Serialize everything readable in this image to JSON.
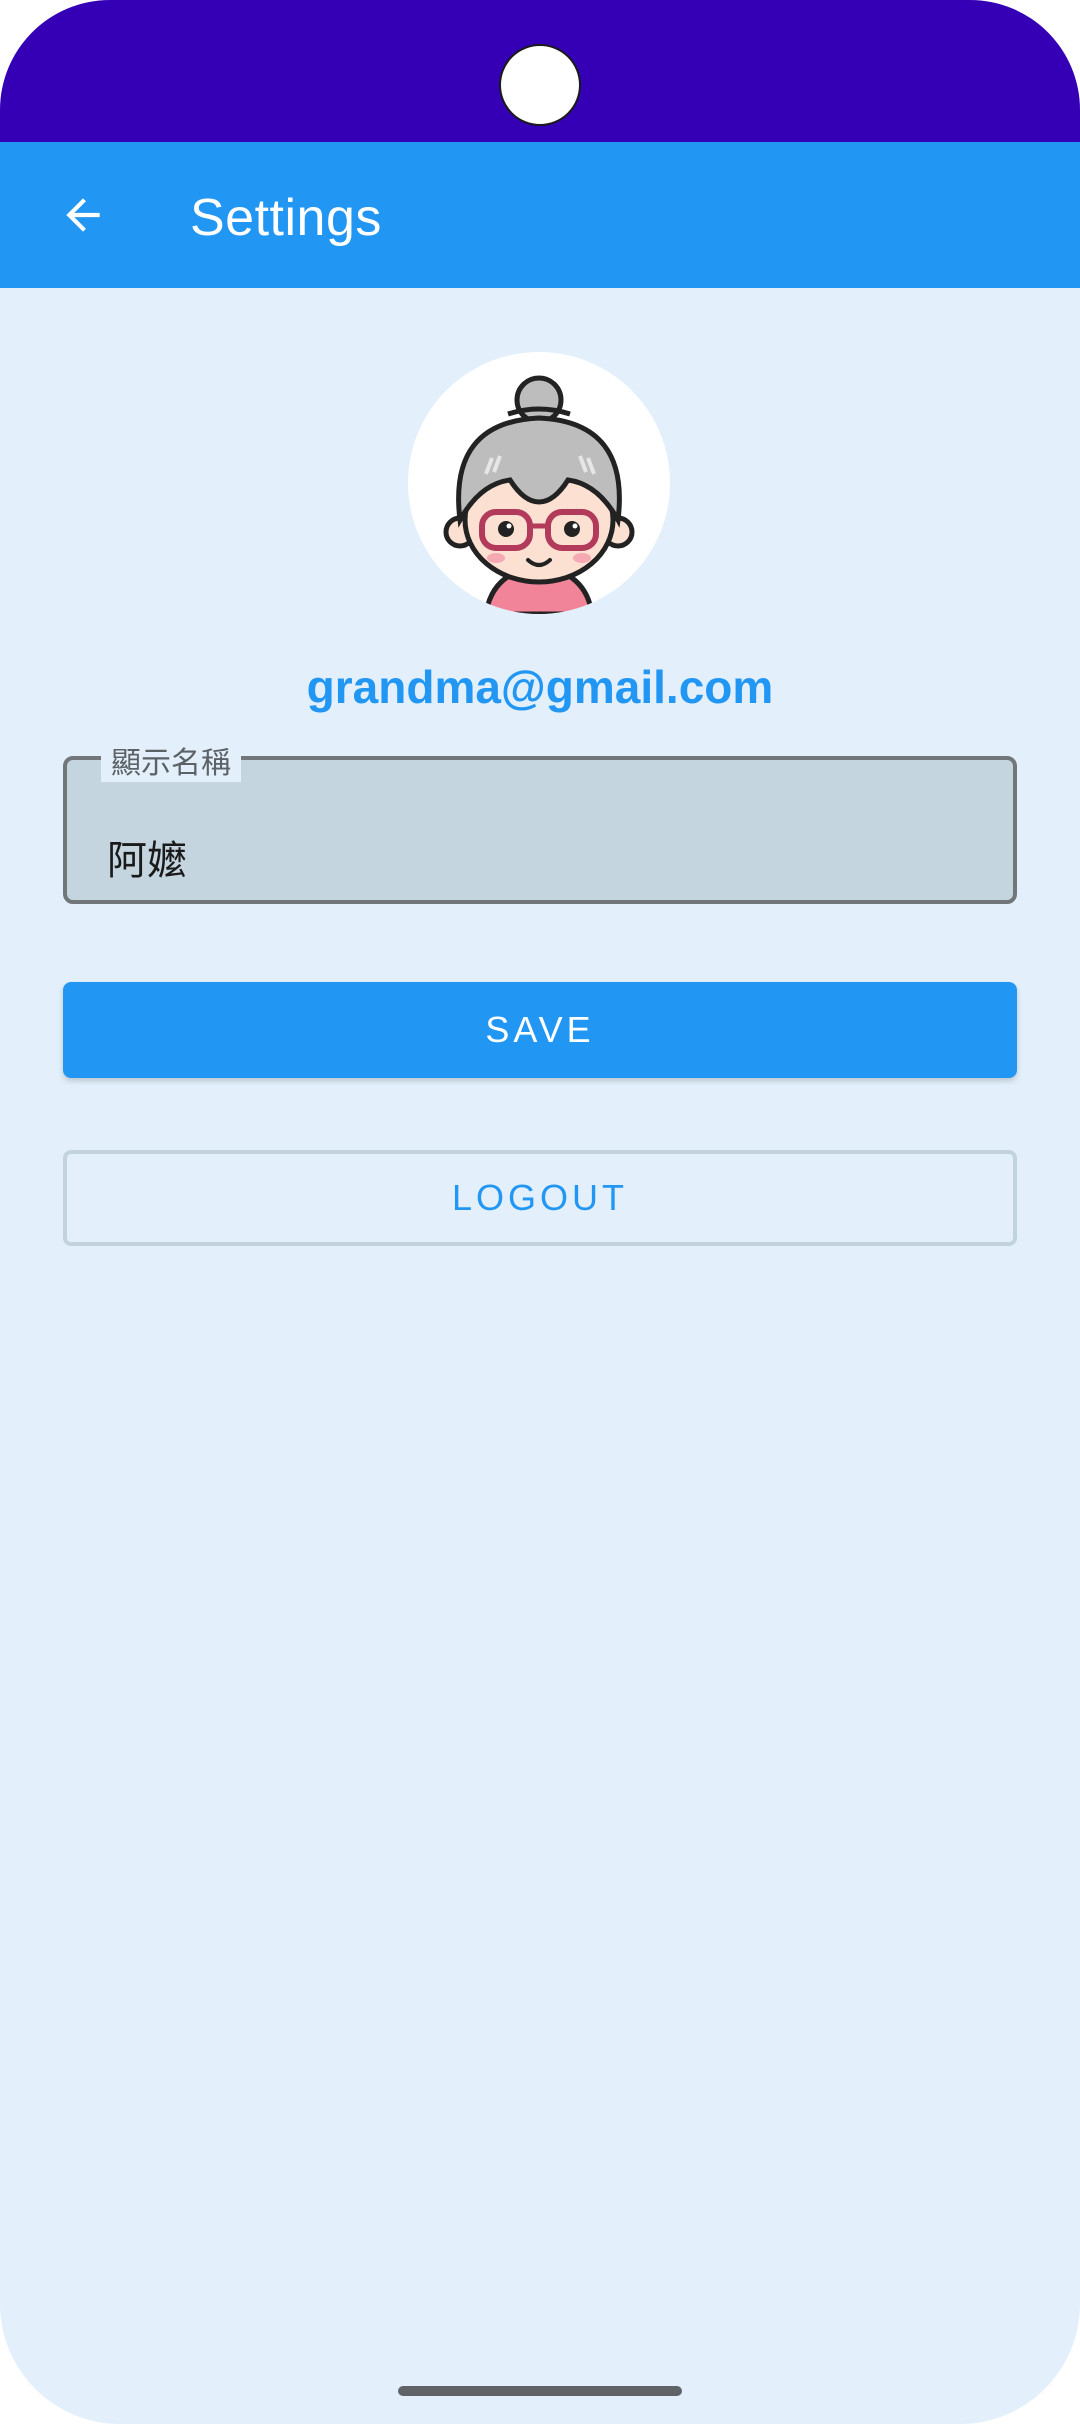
{
  "app_bar": {
    "title": "Settings",
    "back_icon": "arrow-back-icon"
  },
  "profile": {
    "avatar": "grandma-avatar",
    "email": "grandma@gmail.com"
  },
  "display_name_field": {
    "label": "顯示名稱",
    "value": "阿嬤"
  },
  "actions": {
    "save_label": "SAVE",
    "logout_label": "LOGOUT"
  },
  "colors": {
    "status_bar": "#3500B5",
    "app_bar": "#2196F3",
    "background": "#E3F0FC",
    "accent": "#2196F3",
    "field_fill": "#C5D5DF"
  }
}
